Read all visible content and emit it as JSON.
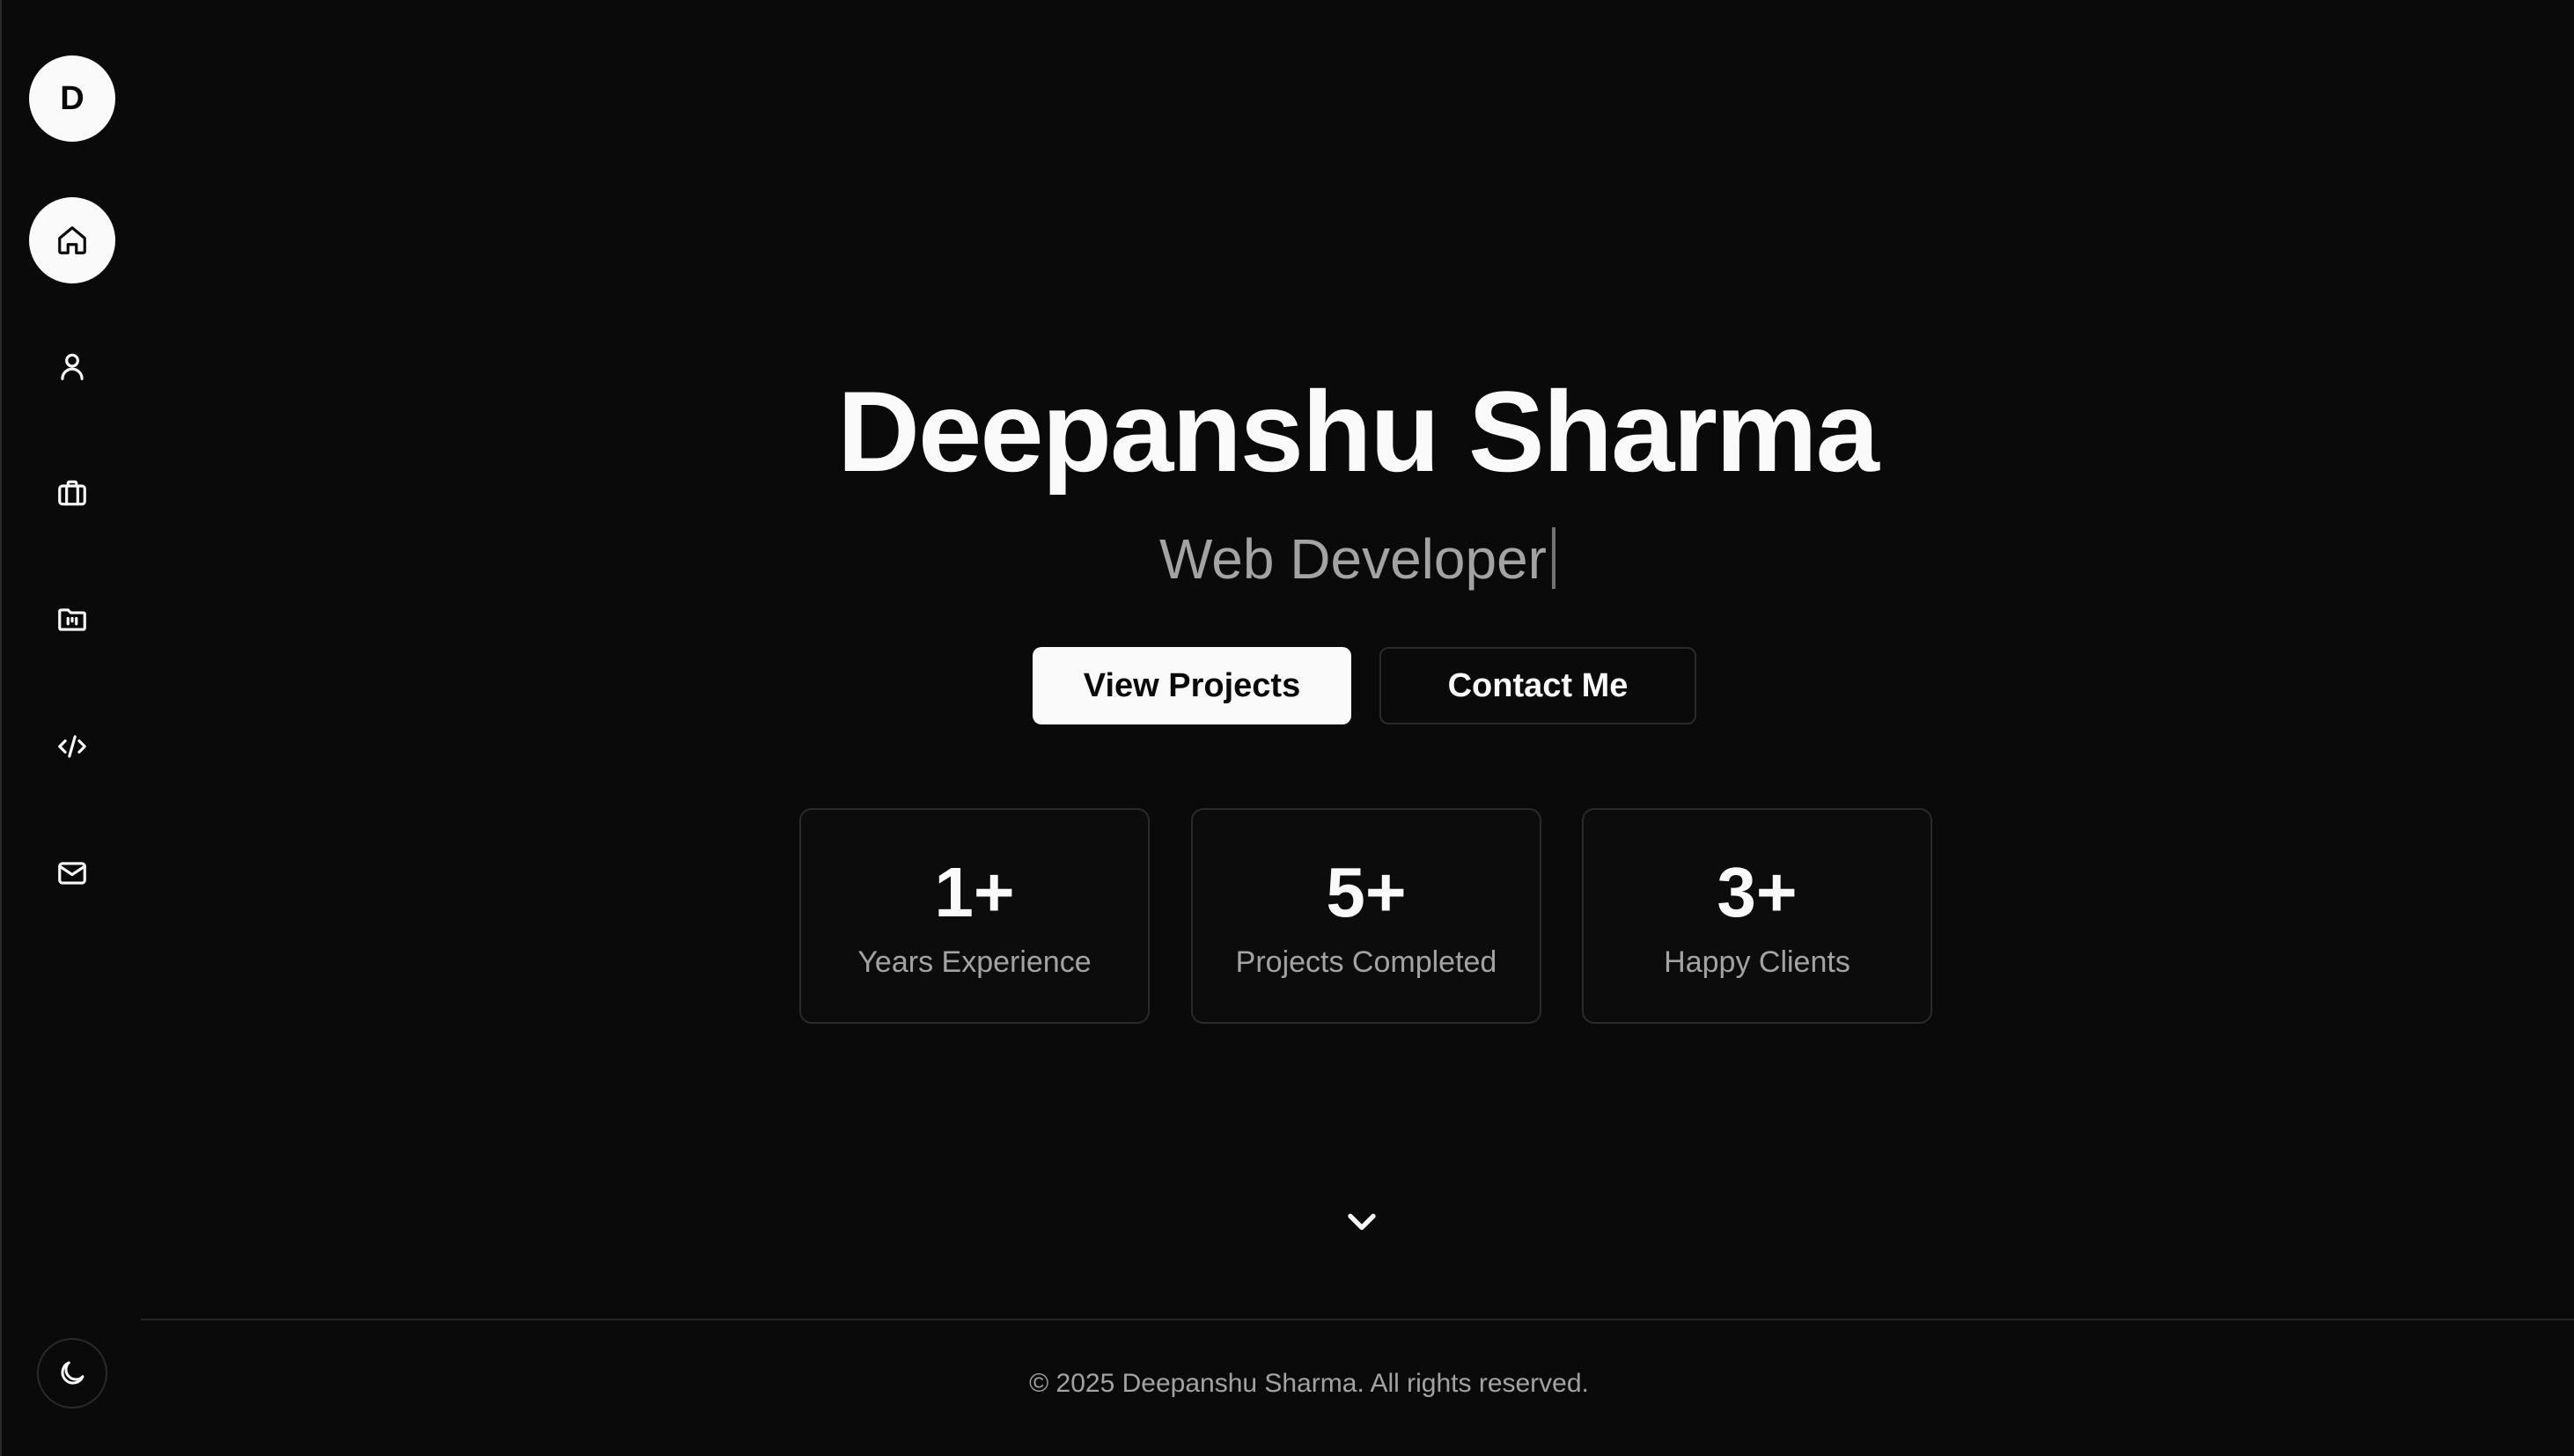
{
  "sidebar": {
    "logo_letter": "D",
    "items": [
      {
        "name": "home",
        "icon": "home-icon",
        "active": true
      },
      {
        "name": "about",
        "icon": "user-icon",
        "active": false
      },
      {
        "name": "experience",
        "icon": "briefcase-icon",
        "active": false
      },
      {
        "name": "projects",
        "icon": "folder-icon",
        "active": false
      },
      {
        "name": "skills",
        "icon": "code-icon",
        "active": false
      },
      {
        "name": "contact",
        "icon": "mail-icon",
        "active": false
      }
    ],
    "theme_toggle_icon": "moon-icon"
  },
  "hero": {
    "title": "Deepanshu Sharma",
    "subtitle": "Web Developer",
    "primary_button": "View Projects",
    "secondary_button": "Contact Me",
    "stats": [
      {
        "value": "1+",
        "label": "Years Experience"
      },
      {
        "value": "5+",
        "label": "Projects Completed"
      },
      {
        "value": "3+",
        "label": "Happy Clients"
      }
    ],
    "scroll_icon": "chevron-down-icon"
  },
  "footer": {
    "copyright": "© 2025 Deepanshu Sharma. All rights reserved."
  },
  "colors": {
    "background": "#0a0a0a",
    "foreground": "#fafafa",
    "muted": "#a3a3a3",
    "border": "#2a2a2a"
  }
}
